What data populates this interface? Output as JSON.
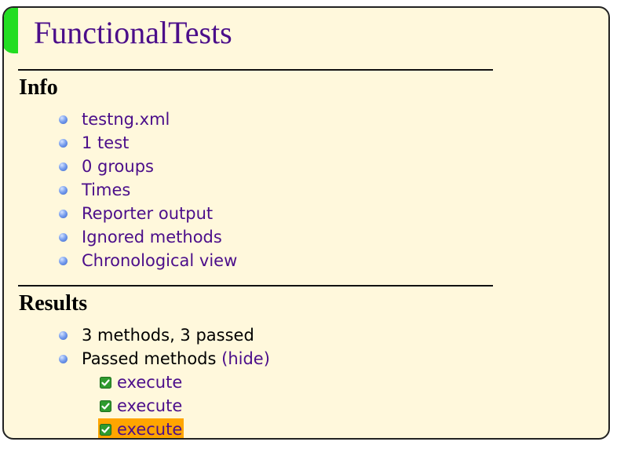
{
  "suite": {
    "title": "FunctionalTests"
  },
  "info": {
    "heading": "Info",
    "items": [
      {
        "label": "testng.xml"
      },
      {
        "label": "1 test"
      },
      {
        "label": "0 groups"
      },
      {
        "label": "Times"
      },
      {
        "label": "Reporter output"
      },
      {
        "label": "Ignored methods"
      },
      {
        "label": "Chronological view"
      }
    ]
  },
  "results": {
    "heading": "Results",
    "summary": "3 methods, 3 passed",
    "passed_label": "Passed methods",
    "hide_link": "(hide)",
    "methods": [
      {
        "name": "execute",
        "selected": false
      },
      {
        "name": "execute",
        "selected": false
      },
      {
        "name": "execute",
        "selected": true
      }
    ]
  },
  "colors": {
    "panel_bg": "#fff8dc",
    "link": "#4b0e8a",
    "accent": "#22dd22",
    "selected": "#ffa500",
    "check": "#2e9b2e"
  },
  "icons": {
    "bullet": "bullet-icon",
    "passed": "checkbox-checked-icon"
  }
}
